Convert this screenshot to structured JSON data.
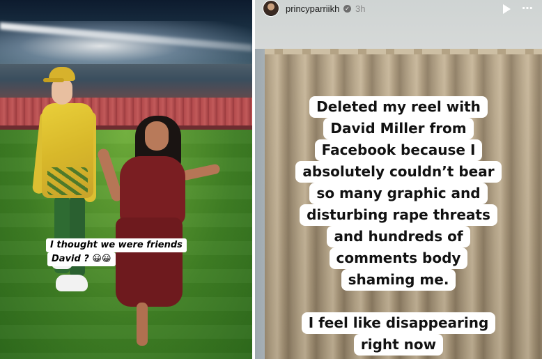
{
  "left_panel": {
    "caption_lines": [
      "I thought we were friends",
      "David ? 😀😀"
    ]
  },
  "right_panel": {
    "header": {
      "username": "princyparriikh",
      "verified_icon": "verified-icon",
      "time": "3h",
      "play_icon": "play-icon",
      "more_icon": "more-options-icon"
    },
    "caption_main": [
      "Deleted my reel with",
      "David Miller from",
      "Facebook because I",
      "absolutely couldn’t bear",
      "so many graphic and",
      "disturbing rape threats",
      "and hundreds of",
      "comments body",
      "shaming me."
    ],
    "caption_second": [
      "I feel like disappearing",
      "right now"
    ]
  },
  "colors": {
    "caption_bg": "#ffffff",
    "caption_text": "#111111",
    "username_text": "#1c1c1c",
    "time_text": "#8a8a8a"
  }
}
